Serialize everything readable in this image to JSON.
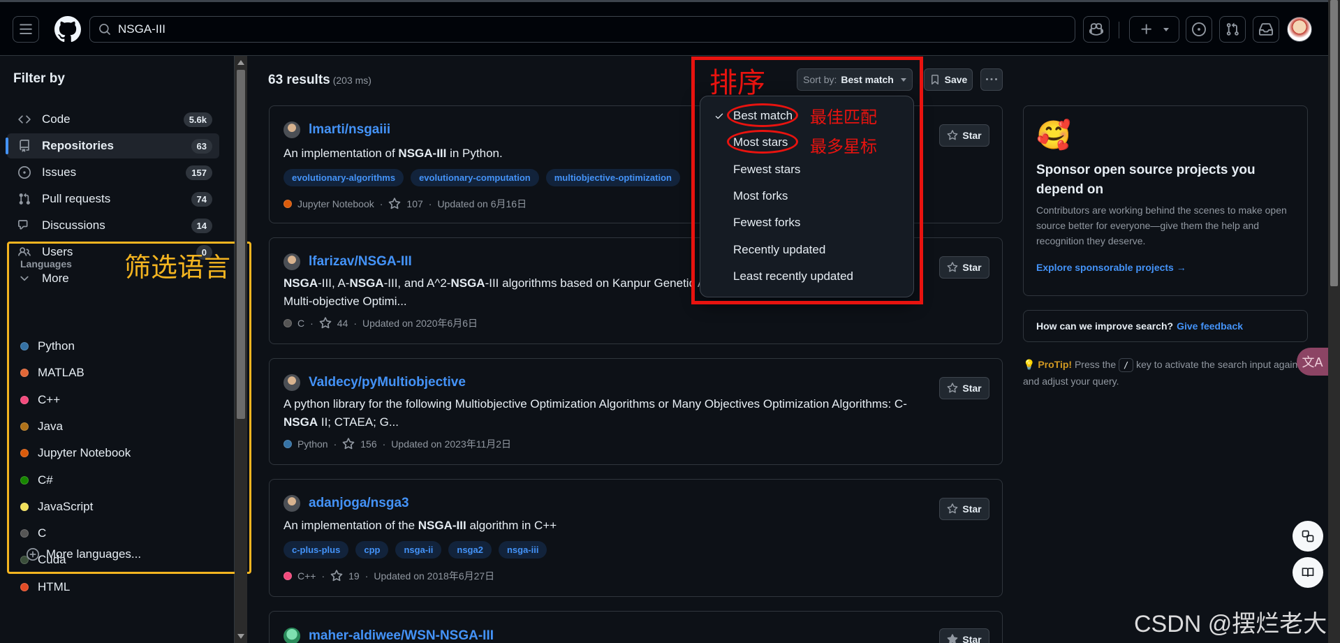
{
  "search": {
    "query": "NSGA-III"
  },
  "sidebar": {
    "title": "Filter by",
    "items": [
      {
        "label": "Code",
        "count": "5.6k",
        "icon": "code-icon"
      },
      {
        "label": "Repositories",
        "count": "63",
        "icon": "repo-icon"
      },
      {
        "label": "Issues",
        "count": "157",
        "icon": "issue-icon"
      },
      {
        "label": "Pull requests",
        "count": "74",
        "icon": "pull-request-icon"
      },
      {
        "label": "Discussions",
        "count": "14",
        "icon": "discussion-icon"
      },
      {
        "label": "Users",
        "count": "0",
        "icon": "people-icon"
      },
      {
        "label": "More",
        "icon": "chevron-down-icon"
      }
    ],
    "languages_heading": "Languages",
    "languages_note": "筛选语言",
    "languages": [
      {
        "name": "Python",
        "color": "#3572A5"
      },
      {
        "name": "MATLAB",
        "color": "#e16737"
      },
      {
        "name": "C++",
        "color": "#f34b7d"
      },
      {
        "name": "Java",
        "color": "#b07219"
      },
      {
        "name": "Jupyter Notebook",
        "color": "#DA5B0B"
      },
      {
        "name": "C#",
        "color": "#178600"
      },
      {
        "name": "JavaScript",
        "color": "#f1e05a"
      },
      {
        "name": "C",
        "color": "#555555"
      },
      {
        "name": "Cuda",
        "color": "#3A4E3A"
      },
      {
        "name": "HTML",
        "color": "#e34c26"
      }
    ],
    "more_languages": "More languages..."
  },
  "results": {
    "count_label": "63 results",
    "time_label": "(203 ms)"
  },
  "sort": {
    "note": "排序",
    "button_prefix": "Sort by:",
    "button_value": "Best match",
    "save_label": "Save",
    "options": [
      "Best match",
      "Most stars",
      "Fewest stars",
      "Most forks",
      "Fewest forks",
      "Recently updated",
      "Least recently updated"
    ],
    "note_best": "最佳匹配",
    "note_stars": "最多星标"
  },
  "repos": [
    {
      "name": "lmarti/nsgaiii",
      "desc_html": "An implementation of <b>NSGA-III</b> in Python.",
      "tags": [
        "evolutionary-algorithms",
        "evolutionary-computation",
        "multiobjective-optimization"
      ],
      "language": "Jupyter Notebook",
      "lang_color": "#DA5B0B",
      "stars": "107",
      "updated": "Updated on 6月16日"
    },
    {
      "name": "lfarizav/NSGA-III",
      "desc_html": "<b>NSGA</b>-III, A-<b>NSGA</b>-III, and A^2-<b>NSGA</b>-III algorithms based on Kanpur Genetic A",
      "desc2": "Multi-objective Optimi...",
      "language": "C",
      "lang_color": "#555555",
      "stars": "44",
      "updated": "Updated on 2020年6月6日"
    },
    {
      "name": "Valdecy/pyMultiobjective",
      "desc_html": "A python library for the following Multiobjective Optimization Algorithms or Many Objectives Optimization Algorithms: C-",
      "desc2_html": "<b>NSGA</b> II; CTAEA; G...",
      "language": "Python",
      "lang_color": "#3572A5",
      "stars": "156",
      "updated": "Updated on 2023年11月2日"
    },
    {
      "name": "adanjoga/nsga3",
      "desc_html": "An implementation of the <b>NSGA-III</b> algorithm in C++",
      "tags": [
        "c-plus-plus",
        "cpp",
        "nsga-ii",
        "nsga2",
        "nsga-iii"
      ],
      "language": "C++",
      "lang_color": "#f34b7d",
      "stars": "19",
      "updated": "Updated on 2018年6月27日"
    },
    {
      "name_prefix": "maher-aldiwee/WSN-",
      "name_bold": "NSGA-III"
    }
  ],
  "star_label": "Star",
  "sponsor": {
    "title": "Sponsor open source projects you depend on",
    "body": "Contributors are working behind the scenes to make open source better for everyone—give them the help and recognition they deserve.",
    "link": "Explore sponsorable projects →"
  },
  "feedback": {
    "question": "How can we improve search?",
    "link": "Give feedback"
  },
  "protip": {
    "label": "ProTip!",
    "before": " Press the ",
    "key": "/",
    "after": " key to activate the search input again and adjust your query."
  },
  "watermark": "CSDN @摆烂老大"
}
